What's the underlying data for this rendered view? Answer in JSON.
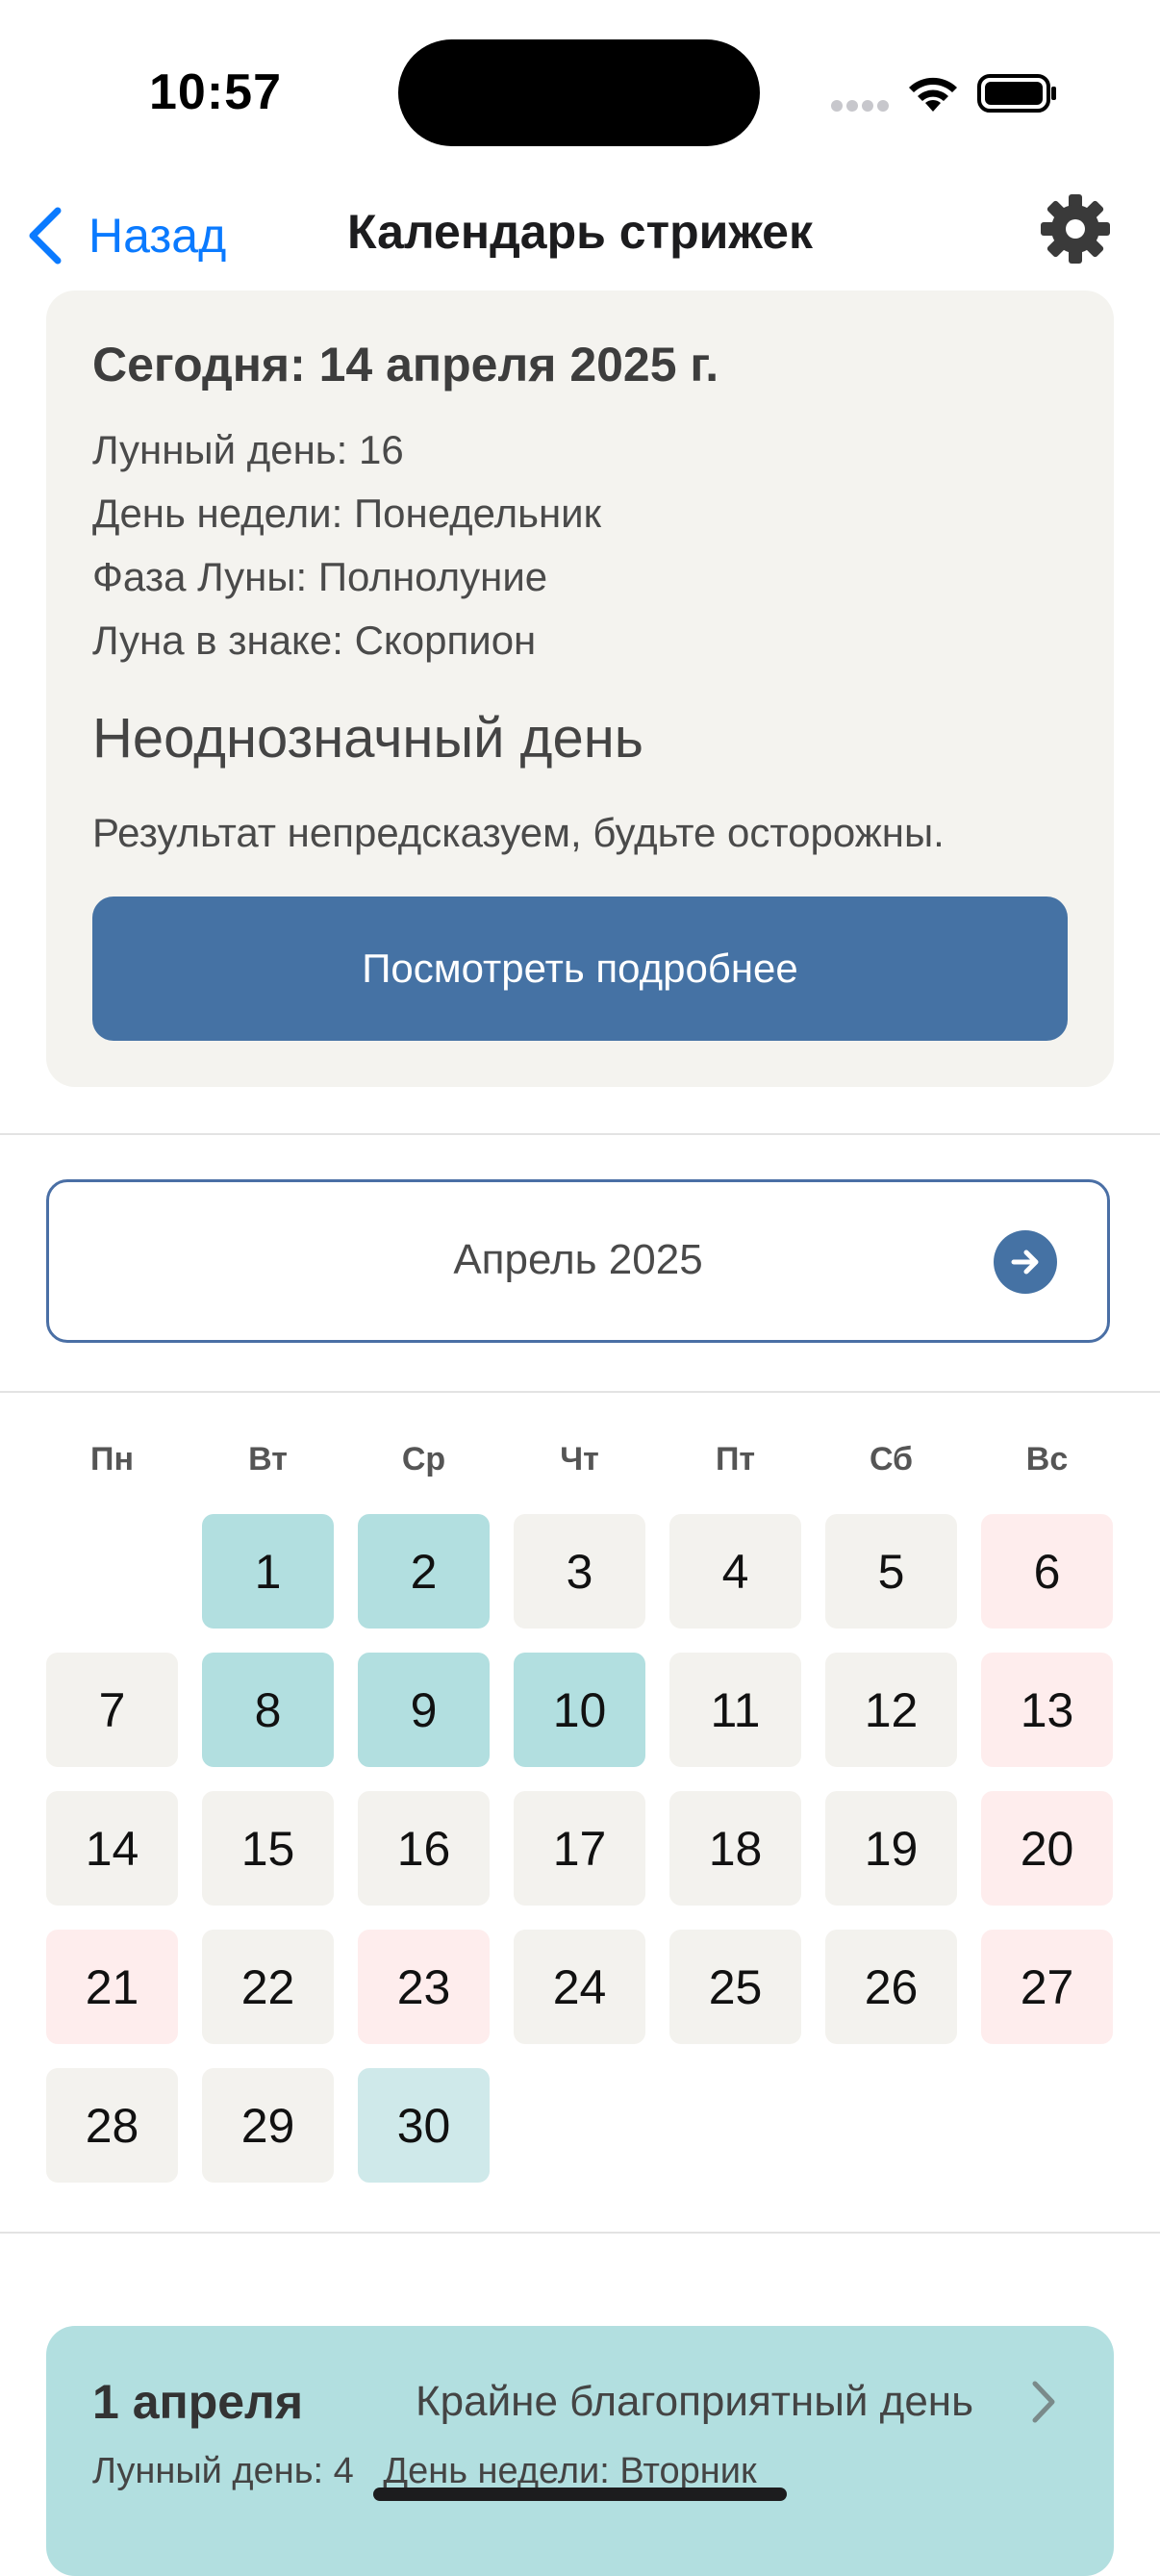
{
  "status": {
    "time": "10:57"
  },
  "nav": {
    "back_label": "Назад",
    "title": "Календарь стрижек"
  },
  "today": {
    "heading": "Сегодня: 14 апреля 2025 г.",
    "lunar_day": "Лунный день: 16",
    "weekday": "День недели: Понедельник",
    "moon_phase": "Фаза Луны: Полнолуние",
    "moon_sign": "Луна в знаке: Скорпион",
    "verdict": "Неоднозначный день",
    "result": "Результат непредсказуем, будьте осторожны.",
    "more_button": "Посмотреть подробнее"
  },
  "month": {
    "label": "Апрель 2025"
  },
  "calendar": {
    "weekdays": [
      "Пн",
      "Вт",
      "Ср",
      "Чт",
      "Пт",
      "Сб",
      "Вс"
    ],
    "legend_colors": {
      "favorable": "#b2dfe0",
      "neutral": "#f3f2ee",
      "unfavorable": "#feeded",
      "light": "#cfe9ea"
    },
    "days": [
      {
        "n": "1",
        "k": "t"
      },
      {
        "n": "2",
        "k": "t"
      },
      {
        "n": "3",
        "k": "g"
      },
      {
        "n": "4",
        "k": "g"
      },
      {
        "n": "5",
        "k": "g"
      },
      {
        "n": "6",
        "k": "p"
      },
      {
        "n": "7",
        "k": "g"
      },
      {
        "n": "8",
        "k": "t"
      },
      {
        "n": "9",
        "k": "t"
      },
      {
        "n": "10",
        "k": "t"
      },
      {
        "n": "11",
        "k": "g"
      },
      {
        "n": "12",
        "k": "g"
      },
      {
        "n": "13",
        "k": "p"
      },
      {
        "n": "14",
        "k": "g"
      },
      {
        "n": "15",
        "k": "g"
      },
      {
        "n": "16",
        "k": "g"
      },
      {
        "n": "17",
        "k": "g"
      },
      {
        "n": "18",
        "k": "g"
      },
      {
        "n": "19",
        "k": "g"
      },
      {
        "n": "20",
        "k": "p"
      },
      {
        "n": "21",
        "k": "p"
      },
      {
        "n": "22",
        "k": "g"
      },
      {
        "n": "23",
        "k": "p"
      },
      {
        "n": "24",
        "k": "g"
      },
      {
        "n": "25",
        "k": "g"
      },
      {
        "n": "26",
        "k": "g"
      },
      {
        "n": "27",
        "k": "p"
      },
      {
        "n": "28",
        "k": "g"
      },
      {
        "n": "29",
        "k": "g"
      },
      {
        "n": "30",
        "k": "l"
      }
    ]
  },
  "day_card": {
    "date": "1 апреля",
    "type": "Крайне благоприятный день",
    "lunar_day": "Лунный день: 4",
    "weekday": "День недели: Вторник"
  }
}
